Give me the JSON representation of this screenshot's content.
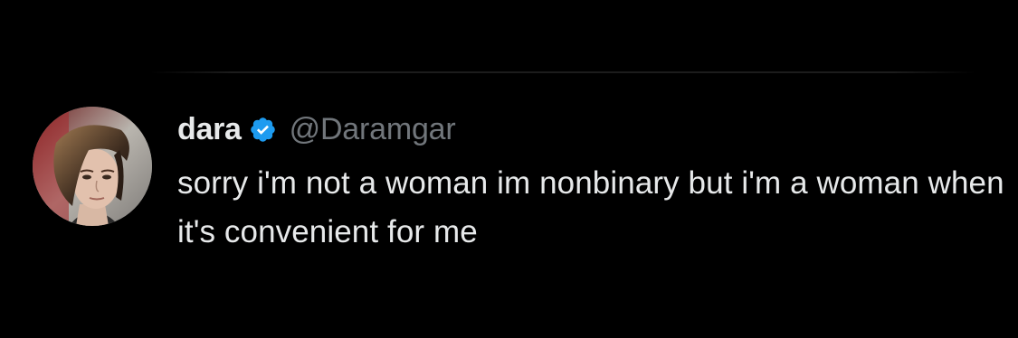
{
  "tweet": {
    "author": {
      "display_name": "dara",
      "handle": "@Daramgar",
      "verified": true,
      "verified_icon": "verified-badge-icon",
      "verified_color": "#1d9bf0"
    },
    "text": "sorry i'm not a woman im nonbinary but i'm a woman when it's convenient for me"
  },
  "theme": {
    "background": "#000000",
    "text_primary": "#e7e9ea",
    "text_secondary": "#71767b"
  }
}
